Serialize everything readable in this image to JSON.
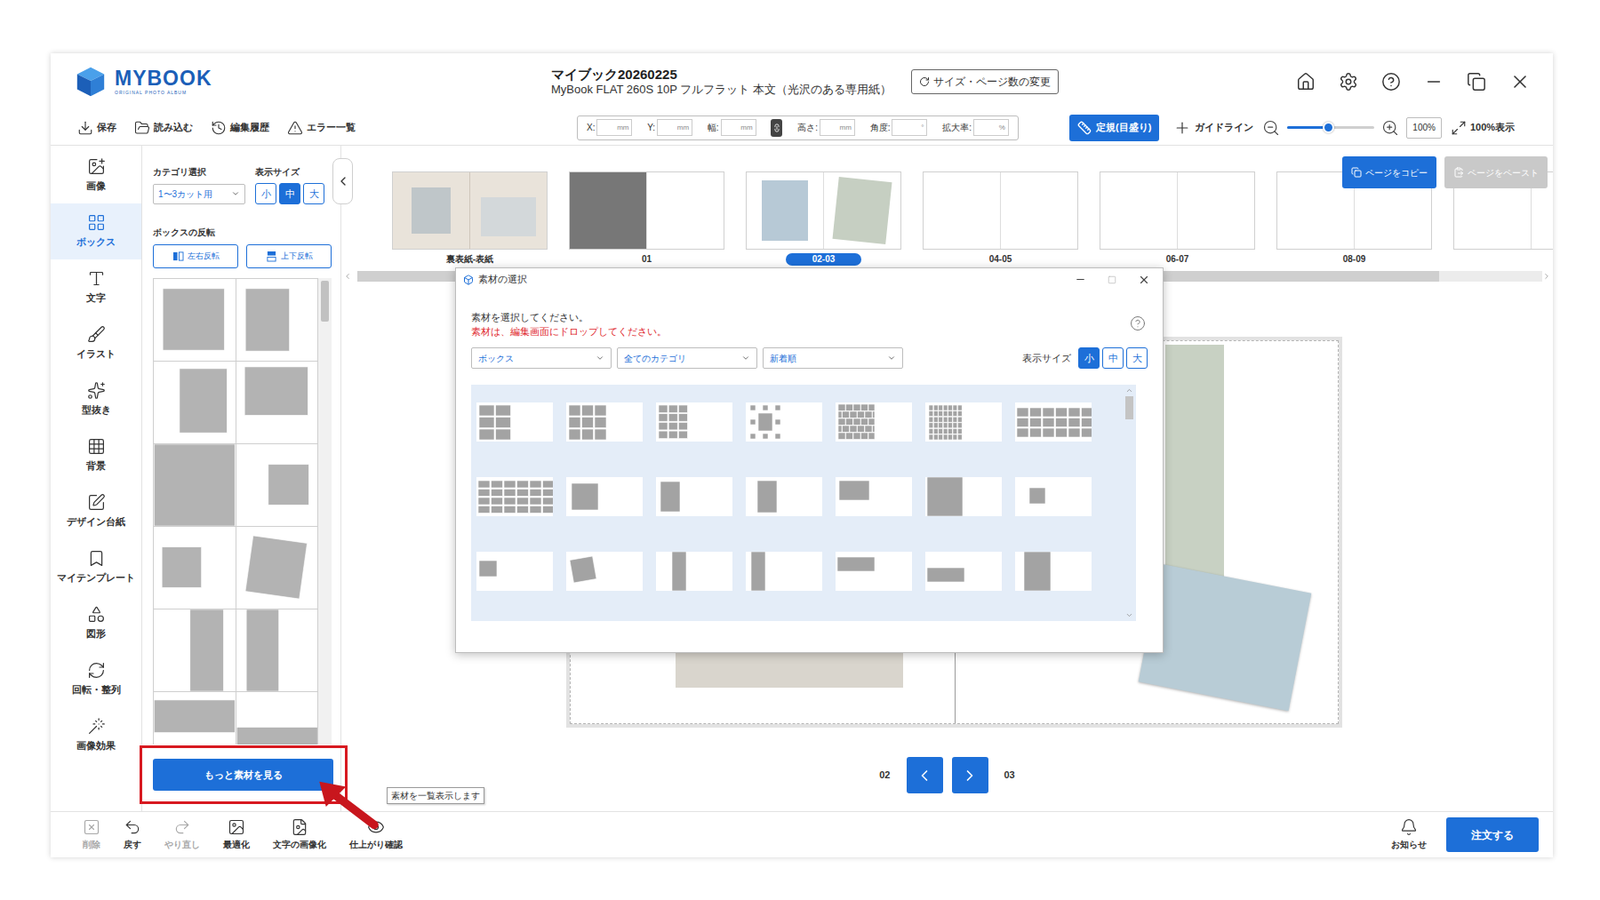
{
  "app": {
    "logo": "MYBOOK",
    "logo_sub": "ORIGINAL PHOTO ALBUM",
    "title": "マイブック20260225",
    "subtitle": "MyBook FLAT 260S 10P フルフラット 本文（光沢のある専用紙）",
    "size_button": "サイズ・ページ数の変更"
  },
  "toolbar": {
    "actions": [
      {
        "label": "保存"
      },
      {
        "label": "読み込む"
      },
      {
        "label": "編集履歴"
      },
      {
        "label": "エラー一覧"
      }
    ],
    "fields": [
      {
        "kind": "field",
        "label": "X:",
        "unit": "mm"
      },
      {
        "kind": "field",
        "label": "Y:",
        "unit": "mm"
      },
      {
        "kind": "field",
        "label": "幅:",
        "unit": "mm"
      },
      {
        "kind": "lock",
        "on": true
      },
      {
        "kind": "field",
        "label": "高さ:",
        "unit": "mm"
      },
      {
        "kind": "field",
        "label": "角度:",
        "unit": "°"
      },
      {
        "kind": "field",
        "label": "拡大率:",
        "unit": "%"
      }
    ],
    "ruler": {
      "label": "定規(目盛り)",
      "on": true
    },
    "guide": "ガイドライン",
    "zoom": {
      "level": 0.47,
      "value": "100%"
    },
    "fit": "100%表示"
  },
  "sidebar": {
    "items": [
      {
        "label": "画像",
        "selected": false
      },
      {
        "label": "ボックス",
        "selected": true
      },
      {
        "label": "文字",
        "selected": false
      },
      {
        "label": "イラスト",
        "selected": false
      },
      {
        "label": "型抜き",
        "selected": false
      },
      {
        "label": "背景",
        "selected": false
      },
      {
        "label": "デザイン台紙",
        "selected": false
      },
      {
        "label": "マイテンプレート",
        "selected": false
      },
      {
        "label": "図形",
        "selected": false
      },
      {
        "label": "回転・整列",
        "selected": false
      },
      {
        "label": "画像効果",
        "selected": false
      }
    ]
  },
  "panel": {
    "category_label": "カテゴリ選択",
    "category_value": "1〜3カット用",
    "size_label": "表示サイズ",
    "sizes": [
      {
        "label": "小",
        "selected": false
      },
      {
        "label": "中",
        "selected": true
      },
      {
        "label": "大",
        "selected": false
      }
    ],
    "flip_label": "ボックスの反転",
    "flip_buttons": [
      "左右反転",
      "上下反転"
    ],
    "items": [
      {
        "kind": "large-square"
      },
      {
        "kind": "tall-right"
      },
      {
        "kind": "tall-center"
      },
      {
        "kind": "wide-top"
      },
      {
        "kind": "full"
      },
      {
        "kind": "small-right"
      },
      {
        "kind": "small-left"
      },
      {
        "kind": "tilted"
      },
      {
        "kind": "strip-right"
      },
      {
        "kind": "strip-left"
      },
      {
        "kind": "band-top"
      },
      {
        "kind": "band-bottom"
      }
    ],
    "more_button": "もっと素材を見る",
    "tooltip": "素材を一覧表示します"
  },
  "pages": {
    "items": [
      {
        "label": "裏表紙-表紙",
        "kind": "cover",
        "selected": false
      },
      {
        "label": "01",
        "kind": "left-dark",
        "selected": false
      },
      {
        "label": "02-03",
        "kind": "photos",
        "selected": true
      },
      {
        "label": "04-05",
        "kind": "blank",
        "selected": false
      },
      {
        "label": "06-07",
        "kind": "blank",
        "selected": false
      },
      {
        "label": "08-09",
        "kind": "blank",
        "selected": false
      },
      {
        "label": "",
        "kind": "blank",
        "selected": false
      }
    ],
    "copy": {
      "label": "ページをコピー",
      "disabled": false
    },
    "paste": {
      "label": "ページをペースト",
      "disabled": true
    }
  },
  "canvas": {
    "prev_page": "02",
    "next_page": "03"
  },
  "dialog": {
    "title": "素材の選択",
    "prompt": "素材を選択してください。",
    "note": "素材は、編集画面にドロップしてください。",
    "filters": [
      "ボックス",
      "全てのカテゴリ",
      "新着順"
    ],
    "size_label": "表示サイズ",
    "sizes": [
      {
        "label": "小",
        "selected": true
      },
      {
        "label": "中",
        "selected": false
      },
      {
        "label": "大",
        "selected": false
      }
    ],
    "items": [
      {
        "kind": "grid-2x3"
      },
      {
        "kind": "grid-3x3"
      },
      {
        "kind": "grid-3x4"
      },
      {
        "kind": "frame"
      },
      {
        "kind": "brick"
      },
      {
        "kind": "mosaic"
      },
      {
        "kind": "wide-grid"
      },
      {
        "kind": "wide-grid-2"
      },
      {
        "kind": "single-square"
      },
      {
        "kind": "single-tall-narrow"
      },
      {
        "kind": "single-tall-center"
      },
      {
        "kind": "single-wide-top"
      },
      {
        "kind": "single-large"
      },
      {
        "kind": "single-small"
      },
      {
        "kind": "tiny"
      },
      {
        "kind": "tilted"
      },
      {
        "kind": "strip-center"
      },
      {
        "kind": "strip-left"
      },
      {
        "kind": "bar-top"
      },
      {
        "kind": "bar-mid"
      },
      {
        "kind": "half-left"
      }
    ]
  },
  "bottom": {
    "actions": [
      {
        "label": "削除",
        "disabled": true
      },
      {
        "label": "戻す",
        "disabled": false
      },
      {
        "label": "やり直し",
        "disabled": true
      },
      {
        "label": "最適化",
        "disabled": false
      },
      {
        "label": "文字の画像化",
        "disabled": false
      },
      {
        "label": "仕上がり確認",
        "disabled": false
      }
    ],
    "notice": "お知らせ",
    "order": "注文する"
  }
}
